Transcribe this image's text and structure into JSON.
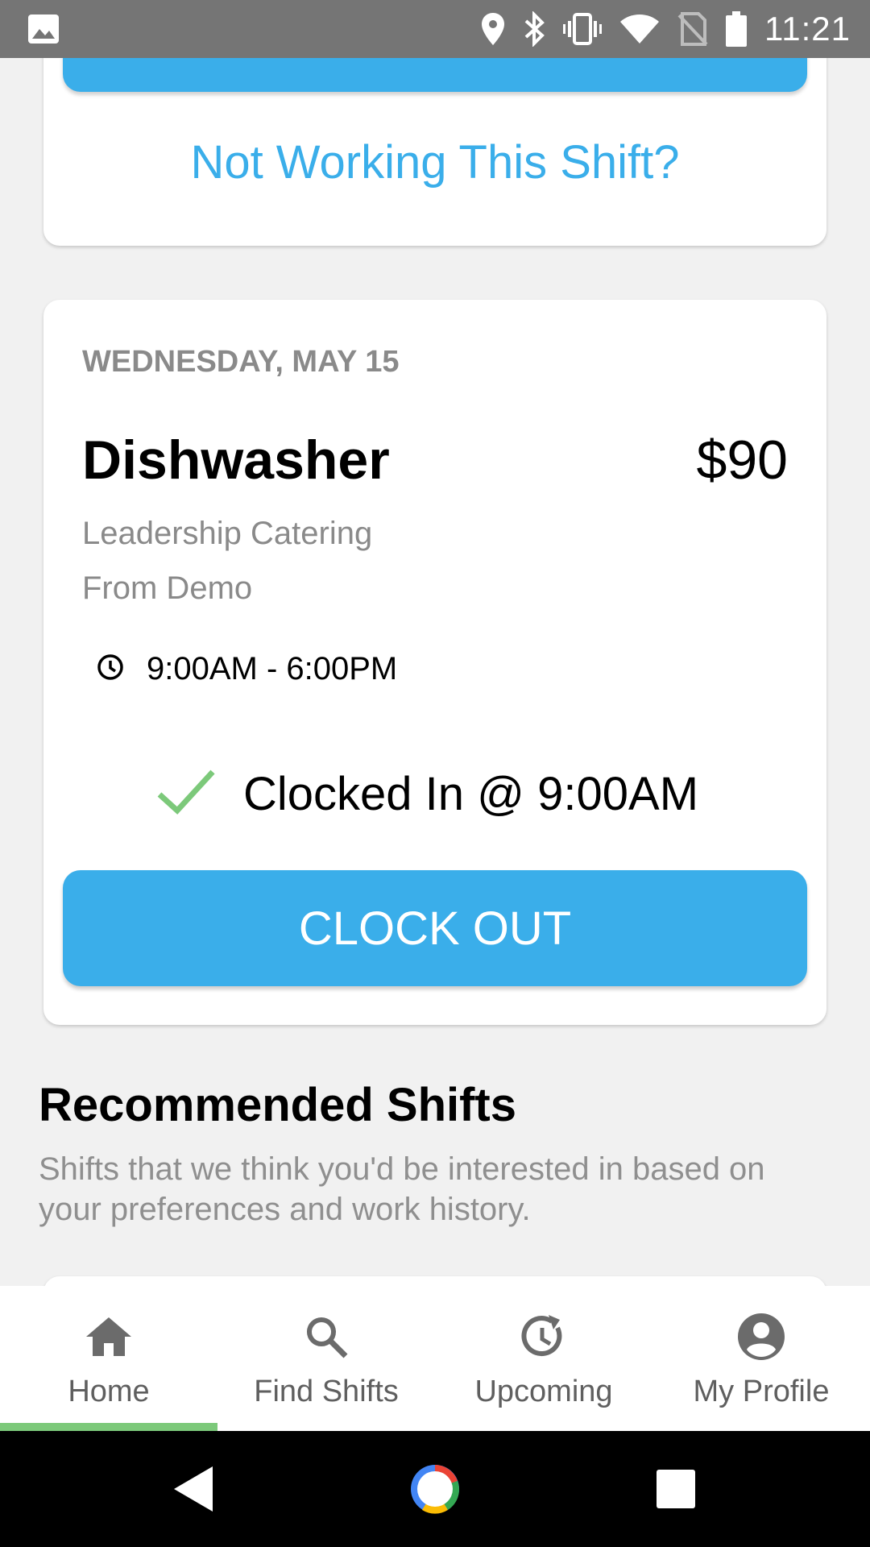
{
  "status_bar": {
    "time": "11:21",
    "icons": [
      "image-icon",
      "location-icon",
      "bluetooth-icon",
      "vibrate-icon",
      "wifi-icon",
      "no-sim-icon",
      "battery-icon"
    ]
  },
  "top_card": {
    "not_working_link": "Not Working This Shift?"
  },
  "shift_card": {
    "date": "WEDNESDAY, MAY 15",
    "title": "Dishwasher",
    "pay": "$90",
    "company": "Leadership Catering",
    "source": "From Demo",
    "time_range": "9:00AM - 6:00PM",
    "clocked_status": "Clocked In @ 9:00AM",
    "clock_out_label": "CLOCK OUT"
  },
  "recommended": {
    "title": "Recommended Shifts",
    "description": "Shifts that we think you'd be interested in based on your preferences and work history."
  },
  "bottom_nav": {
    "items": [
      {
        "label": "Home",
        "icon": "home-icon",
        "active": true
      },
      {
        "label": "Find Shifts",
        "icon": "search-icon",
        "active": false
      },
      {
        "label": "Upcoming",
        "icon": "history-icon",
        "active": false
      },
      {
        "label": "My Profile",
        "icon": "profile-icon",
        "active": false
      }
    ]
  },
  "colors": {
    "accent": "#3aaeea",
    "active_indicator": "#7cc97a",
    "check": "#7cc97a",
    "status_bar": "#757575"
  }
}
